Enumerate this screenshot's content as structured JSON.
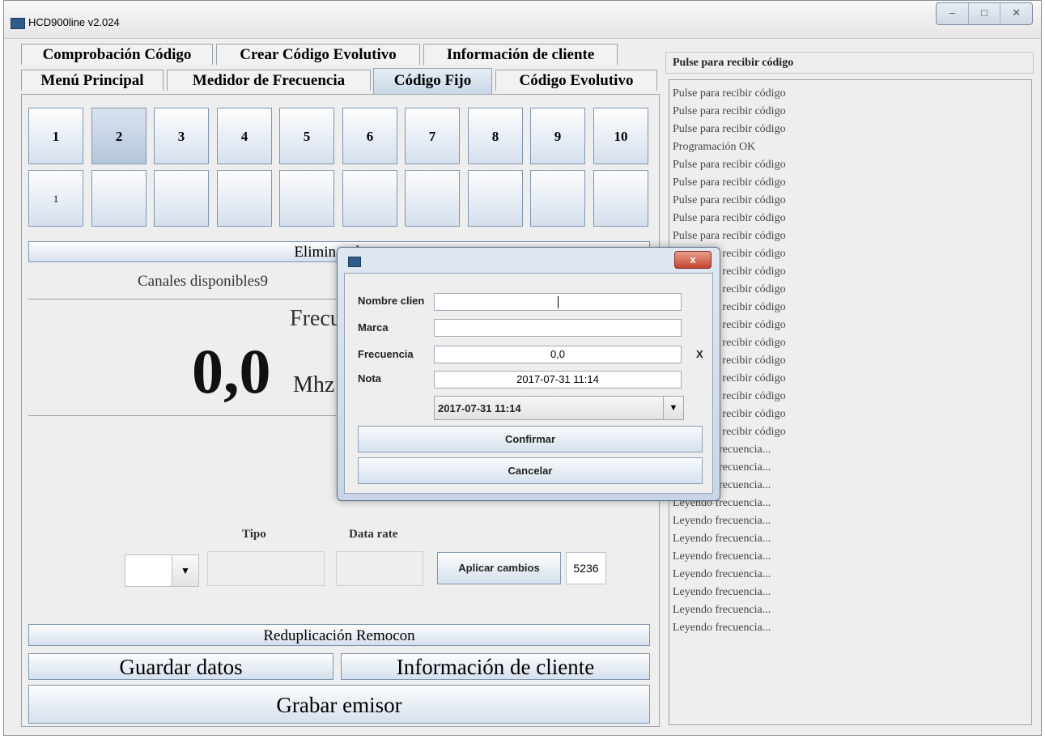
{
  "window": {
    "title": "HCD900line v2.024",
    "controls": [
      "–",
      "□",
      "✕"
    ]
  },
  "tabs_row1": [
    "Comprobación Código",
    "Crear Código Evolutivo",
    "Información de cliente"
  ],
  "tabs_row2": [
    "Menú Principal",
    "Medidor de Frecuencia",
    "Código Fijo",
    "Código Evolutivo"
  ],
  "active_tab": "Código Fijo",
  "channels": [
    "1",
    "2",
    "3",
    "4",
    "5",
    "6",
    "7",
    "8",
    "9",
    "10"
  ],
  "selected_channel": "2",
  "slots": [
    "1",
    "",
    "",
    "",
    "",
    "",
    "",
    "",
    "",
    ""
  ],
  "main": {
    "delete_button": "Eliminar datos",
    "available_channels": "Canales disponibles9",
    "freq_title": "Frecuencia",
    "freq_value": "0,0",
    "freq_unit": "Mhz",
    "tipo_label": "Tipo",
    "datarate_label": "Data rate",
    "apply_button": "Aplicar cambios",
    "counter_value": "5236",
    "reduplicacion_button": "Reduplicación Remocon",
    "guardar_button": "Guardar datos",
    "info_cliente_button": "Información de cliente",
    "grabar_button": "Grabar emisor"
  },
  "right_panel": {
    "header": "Pulse para recibir código",
    "log": [
      "Pulse para recibir código",
      "Pulse para recibir código",
      "Pulse para recibir código",
      "Programación OK",
      "Pulse para recibir código",
      "Pulse para recibir código",
      "Pulse para recibir código",
      "Pulse para recibir código",
      "Pulse para recibir código",
      "Pulse para recibir código",
      "Pulse para recibir código",
      "Pulse para recibir código",
      "Pulse para recibir código",
      "Pulse para recibir código",
      "Pulse para recibir código",
      "Pulse para recibir código",
      "Pulse para recibir código",
      "Pulse para recibir código",
      "Pulse para recibir código",
      "Pulse para recibir código",
      "Leyendo frecuencia...",
      "Leyendo frecuencia...",
      "Leyendo frecuencia...",
      "Leyendo frecuencia...",
      "Leyendo frecuencia...",
      "Leyendo frecuencia...",
      "Leyendo frecuencia...",
      "Leyendo frecuencia...",
      "Leyendo frecuencia...",
      "Leyendo frecuencia...",
      "Leyendo frecuencia..."
    ]
  },
  "dialog": {
    "close": "x",
    "nombre_label": "Nombre clien",
    "nombre_value": "",
    "marca_label": "Marca",
    "marca_value": "",
    "frecuencia_label": "Frecuencia",
    "frecuencia_value": "0,0",
    "frecuencia_suffix": "X",
    "nota_label": "Nota",
    "nota_value": "2017-07-31 11:14",
    "date_select": "2017-07-31 11:14",
    "confirm_button": "Confirmar",
    "cancel_button": "Cancelar"
  }
}
